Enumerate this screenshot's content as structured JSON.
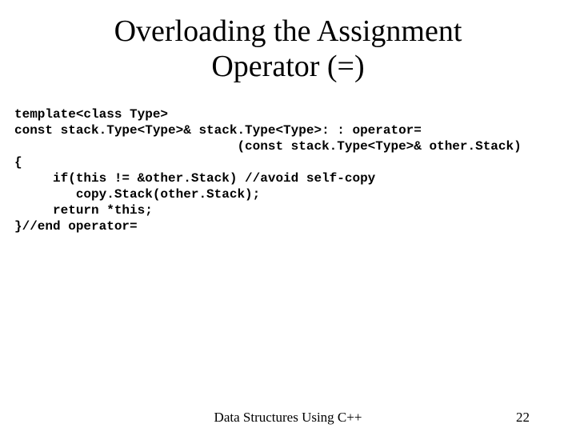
{
  "title_line1": "Overloading the Assignment",
  "title_line2": "Operator (=)",
  "code": {
    "l1": "template<class Type>",
    "l2": "const stack.Type<Type>& stack.Type<Type>: : operator=",
    "l3": "                             (const stack.Type<Type>& other.Stack)",
    "l4": "{",
    "l5": "     if(this != &other.Stack) //avoid self-copy",
    "l6": "        copy.Stack(other.Stack);",
    "l7": "     return *this;",
    "l8": "}//end operator="
  },
  "footer": {
    "center": "Data Structures Using C++",
    "page": "22"
  }
}
